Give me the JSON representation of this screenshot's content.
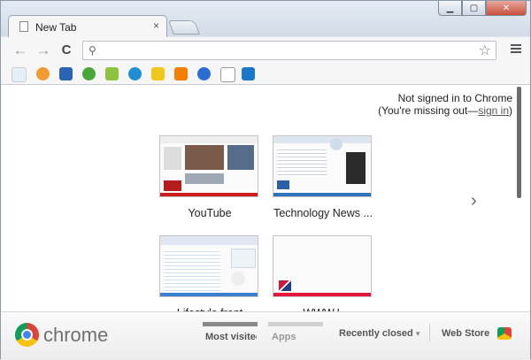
{
  "tab": {
    "title": "New Tab",
    "close": "×"
  },
  "window": {
    "minimize": "▁",
    "maximize": "▢",
    "close": "✕"
  },
  "toolbar": {
    "back": "←",
    "forward": "→",
    "reload": "C",
    "search_glyph": "⚲",
    "star": "☆"
  },
  "signin": {
    "line1": "Not signed in to Chrome",
    "line2_prefix": "(You're missing out—",
    "link": "sign in",
    "line2_suffix": ")"
  },
  "tiles": [
    {
      "label": "YouTube",
      "accent": "#cc1b1b"
    },
    {
      "label": "Technology News ...",
      "accent": "#2e72b8"
    },
    {
      "label": "Lifestyle front",
      "accent": "#3b7fd1"
    },
    {
      "label": "WWW.L",
      "accent": "#e3163d"
    }
  ],
  "next_arrow": "›",
  "footer": {
    "brand": "chrome",
    "most_visited": "Most visited",
    "apps": "Apps",
    "recently_closed": "Recently closed",
    "caret": "▾",
    "web_store": "Web Store"
  }
}
